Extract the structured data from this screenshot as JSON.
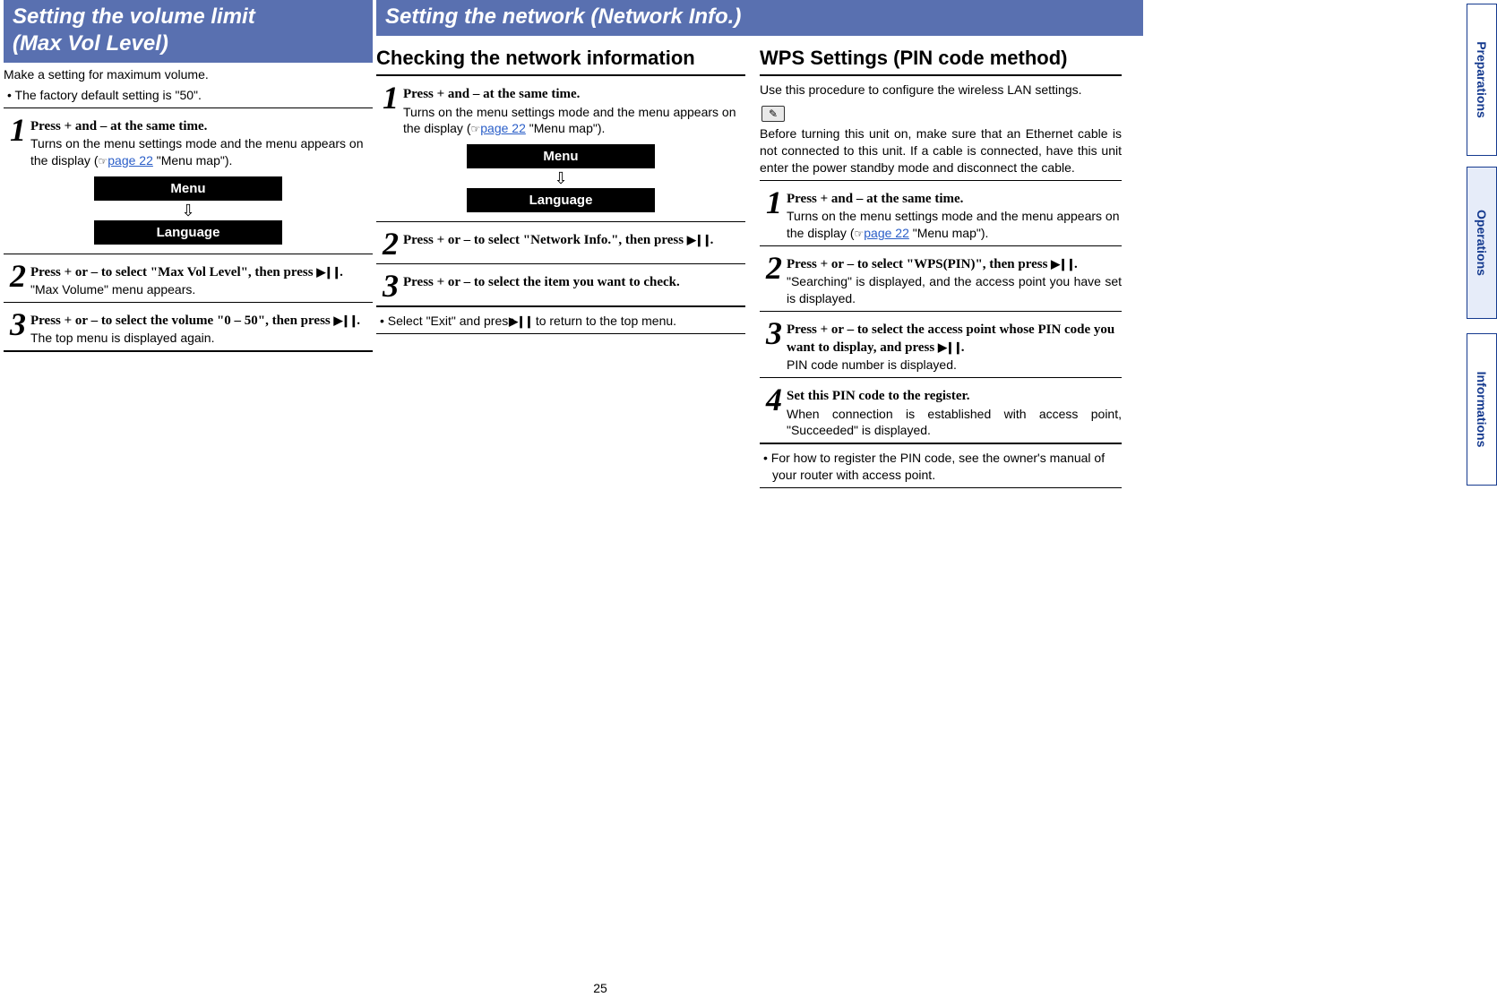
{
  "page_number": "25",
  "tabs": {
    "prep": "Preparations",
    "ops": "Operations",
    "info": "Informations"
  },
  "menu_labels": {
    "menu": "Menu",
    "language": "Language"
  },
  "page_ref": {
    "pointer": "☞",
    "text": "page 22",
    "suffix": " \"Menu map\")."
  },
  "left": {
    "banner_line1": "Setting the volume limit",
    "banner_line2": "(Max Vol Level)",
    "intro": "Make a setting for maximum volume.",
    "intro_bullet": "• The factory default setting is \"50\".",
    "steps": [
      {
        "n": "1",
        "bold": "Press + and – at the same time.",
        "body": "Turns on the menu settings mode and the menu appears on the display ("
      },
      {
        "n": "2",
        "bold": "Press + or – to select \"Max Vol Level\", then press ",
        "with_btn": true,
        "after": ".",
        "body": "\"Max Volume\" menu appears."
      },
      {
        "n": "3",
        "bold": "Press + or – to select the volume \"0  –  50\", then press ",
        "with_btn": true,
        "after": ".",
        "body": "The top menu is displayed again."
      }
    ]
  },
  "right": {
    "banner": "Setting the network (Network Info.)",
    "check": {
      "heading": "Checking the network information",
      "steps": [
        {
          "n": "1",
          "bold": "Press + and – at the same time.",
          "body": "Turns on the menu settings mode and the menu appears on the display ("
        },
        {
          "n": "2",
          "bold": "Press + or – to select \"Network Info.\", then press ",
          "with_btn": true,
          "after": "."
        },
        {
          "n": "3",
          "bold": "Press + or – to select the item you want to check."
        }
      ],
      "footnote": "• Select \"Exit\" and press ",
      "footnote_after": " to return to the top menu."
    },
    "wps": {
      "heading": "WPS Settings (PIN code method)",
      "intro": "Use this procedure to configure the wireless LAN settings.",
      "note": "Before turning this unit on, make sure that an Ethernet cable is not connected to this unit. If a cable is connected, have this unit enter the power standby mode and disconnect the cable.",
      "steps": [
        {
          "n": "1",
          "bold": "Press + and – at the same time.",
          "body": "Turns on the menu settings mode and the menu appears on the display ("
        },
        {
          "n": "2",
          "bold": "Press + or – to select \"WPS(PIN)\", then press ",
          "with_btn": true,
          "after": ".",
          "body": "\"Searching\" is displayed, and the access point you have set is displayed."
        },
        {
          "n": "3",
          "bold": "Press + or – to select the access point whose PIN code you want to display, and press ",
          "with_btn": true,
          "after": ".",
          "body": "PIN code number is displayed."
        },
        {
          "n": "4",
          "bold": "Set this PIN code to the register.",
          "body": "When connection is established with access point, \"Succeeded\" is displayed."
        }
      ],
      "footnote": "• For how to register the PIN code, see the owner's manual of your router with access point."
    }
  }
}
